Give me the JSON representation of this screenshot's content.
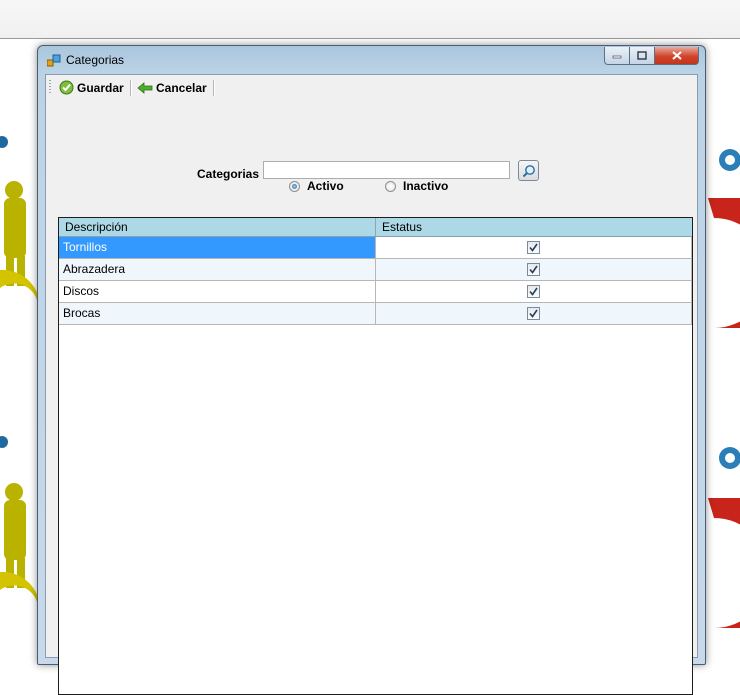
{
  "window": {
    "title": "Categorias",
    "icon": "form-icon"
  },
  "toolbar": {
    "save_label": "Guardar",
    "cancel_label": "Cancelar"
  },
  "search": {
    "label": "Categorias",
    "value": "",
    "button_icon": "search-icon"
  },
  "filter": {
    "active_label": "Activo",
    "inactive_label": "Inactivo",
    "selected": "Activo"
  },
  "grid": {
    "columns": [
      "Descripción",
      "Estatus"
    ],
    "rows": [
      {
        "descripcion": "Tornillos",
        "estatus": true
      },
      {
        "descripcion": "Abrazadera",
        "estatus": true
      },
      {
        "descripcion": "Discos",
        "estatus": true
      },
      {
        "descripcion": "Brocas",
        "estatus": true
      }
    ],
    "selected_row": 0
  },
  "colors": {
    "header_bg": "#add8e6",
    "selection": "#3399ff",
    "close_button": "#c3341c"
  }
}
